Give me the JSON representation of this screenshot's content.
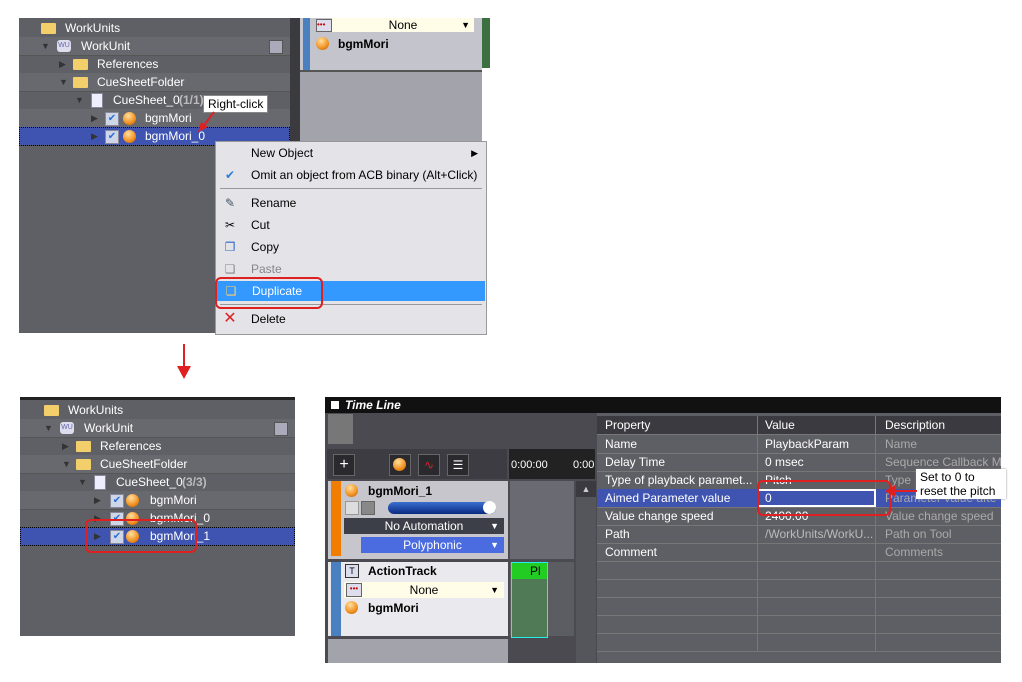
{
  "top_tree": {
    "items": [
      {
        "label": "WorkUnits",
        "icon": "folder-open-icon"
      },
      {
        "label": "WorkUnit",
        "icon": "workunit-icon"
      },
      {
        "label": "References",
        "icon": "folder-icon"
      },
      {
        "label": "CueSheetFolder",
        "icon": "folder-open-icon"
      },
      {
        "label": "CueSheet_0",
        "count": "(1/1)",
        "icon": "cuesheet-icon"
      },
      {
        "label": "bgmMori",
        "icon": "cue-icon"
      },
      {
        "label": "bgmMori_0",
        "icon": "cue-icon"
      }
    ]
  },
  "top_track": {
    "selector_value": "None",
    "cue_name": "bgmMori"
  },
  "annotation_right_click": "Right-click",
  "context_menu": {
    "items": [
      {
        "label": "New Object",
        "icon": "",
        "submenu": true
      },
      {
        "label": "Omit an object from ACB binary (Alt+Click)",
        "icon": "check-icon"
      },
      {
        "label": "Rename",
        "icon": "pencil-icon"
      },
      {
        "label": "Cut",
        "icon": "scissors-icon"
      },
      {
        "label": "Copy",
        "icon": "copy-icon"
      },
      {
        "label": "Paste",
        "icon": "paste-icon",
        "disabled": true
      },
      {
        "label": "Duplicate",
        "icon": "duplicate-icon",
        "highlighted": true
      },
      {
        "label": "Delete",
        "icon": "delete-x-icon"
      }
    ]
  },
  "bottom_tree": {
    "items": [
      {
        "label": "WorkUnits"
      },
      {
        "label": "WorkUnit"
      },
      {
        "label": "References"
      },
      {
        "label": "CueSheetFolder"
      },
      {
        "label": "CueSheet_0",
        "count": "(3/3)"
      },
      {
        "label": "bgmMori"
      },
      {
        "label": "bgmMori_0"
      },
      {
        "label": "bgmMori_1"
      }
    ]
  },
  "timeline": {
    "title": "Time Line",
    "time_start": "0:00:00",
    "time_next": "0:00",
    "track1": {
      "name": "bgmMori_1",
      "automation": "No Automation",
      "mode": "Polyphonic",
      "color": "#f07d00"
    },
    "track2": {
      "name": "ActionTrack",
      "selector": "None",
      "cue": "bgmMori",
      "color": "#4a7fc0"
    },
    "block_label": "Pl"
  },
  "properties": {
    "headers": [
      "Property",
      "Value",
      "Description"
    ],
    "rows": [
      {
        "property": "Name",
        "value": "PlaybackParam",
        "description": "Name"
      },
      {
        "property": "Delay Time",
        "value": "0 msec",
        "description": "Sequence Callback M"
      },
      {
        "property": "Type of playback paramet...",
        "value": "Pitch",
        "description": "Type"
      },
      {
        "property": "Aimed Parameter value",
        "value": "0",
        "description": "Parameter value afte"
      },
      {
        "property": "Value change speed",
        "value": "2400.00",
        "description": "Value change speed"
      },
      {
        "property": "Path",
        "value": "/WorkUnits/WorkU...",
        "description": "Path on Tool"
      },
      {
        "property": "Comment",
        "value": "",
        "description": "Comments"
      }
    ]
  },
  "annotation_set_zero": {
    "line1": "Set to 0 to",
    "line2": "reset the pitch"
  },
  "colors": {
    "selection": "#3f54b0",
    "menu_highlight": "#3399ff",
    "annotation_red": "#e02020"
  }
}
